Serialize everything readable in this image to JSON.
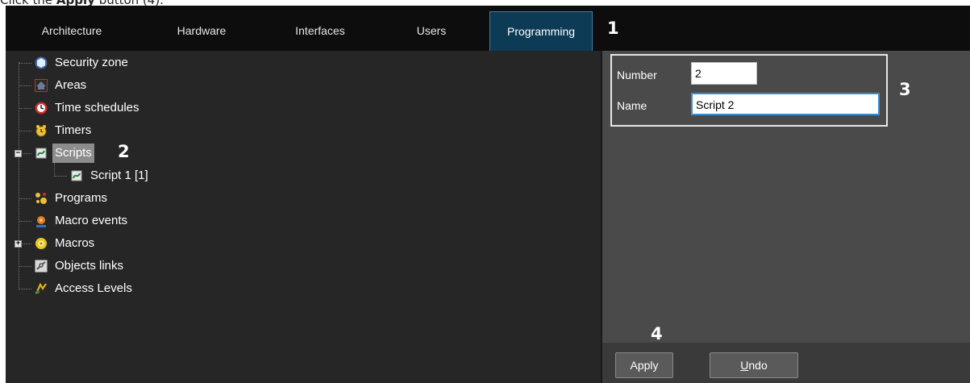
{
  "caption": {
    "prefix": "Click the ",
    "bold": "Apply",
    "suffix": " button (4)."
  },
  "tabs": [
    {
      "label": "Architecture",
      "active": false
    },
    {
      "label": "Hardware",
      "active": false
    },
    {
      "label": "Interfaces",
      "active": false
    },
    {
      "label": "Users",
      "active": false
    },
    {
      "label": "Programming",
      "active": true
    }
  ],
  "callouts": {
    "one": "1",
    "two": "2",
    "three": "3",
    "four": "4"
  },
  "tree": {
    "items": [
      {
        "label": "Security zone",
        "icon": "security-zone-icon"
      },
      {
        "label": "Areas",
        "icon": "area-icon"
      },
      {
        "label": "Time schedules",
        "icon": "clock-icon"
      },
      {
        "label": "Timers",
        "icon": "timer-icon"
      },
      {
        "label": "Scripts",
        "icon": "script-icon",
        "expanded": true,
        "selected": true
      },
      {
        "label": "Script 1 [1]",
        "icon": "script-icon",
        "child": true
      },
      {
        "label": "Programs",
        "icon": "programs-icon"
      },
      {
        "label": "Macro events",
        "icon": "macro-event-icon"
      },
      {
        "label": "Macros",
        "icon": "macro-icon",
        "collapsed": true
      },
      {
        "label": "Objects links",
        "icon": "link-icon"
      },
      {
        "label": "Access Levels",
        "icon": "access-level-icon"
      }
    ]
  },
  "properties": {
    "number_label": "Number",
    "number_value": "2",
    "name_label": "Name",
    "name_value": "Script 2"
  },
  "buttons": {
    "apply_label": "Apply",
    "undo_label": "Undo"
  },
  "colors": {
    "tab_active_bg": "#0d3a55",
    "tree_bg": "#262626",
    "panel_bg": "#4a4a4a"
  }
}
